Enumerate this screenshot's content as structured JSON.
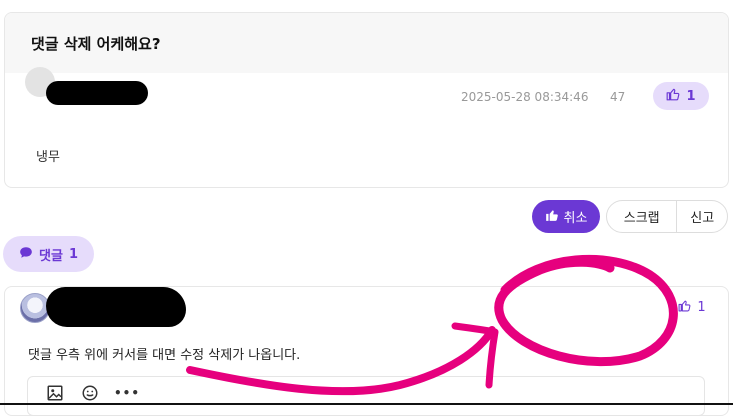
{
  "post": {
    "title": "댓글 삭제 어케해요?",
    "date": "2025-05-28 08:34:46",
    "views": "47",
    "likes": "1",
    "body": "냉무"
  },
  "actions": {
    "cancel_label": "취소",
    "scrap_label": "스크랩",
    "report_label": "신고"
  },
  "comments": {
    "toggle_label": "댓글",
    "count": "1",
    "items": [
      {
        "likes": "1",
        "text": "댓글 우측 위에 커서를 대면 수정 삭제가 나옵니다."
      }
    ]
  },
  "editor_toolbar": {
    "icons": [
      "image-icon",
      "emoji-icon",
      "more-icon"
    ],
    "more_label": "•••"
  },
  "colors": {
    "accent": "#6b38d4",
    "accent_light": "#e6dcfb",
    "annotation": "#e6007e"
  }
}
